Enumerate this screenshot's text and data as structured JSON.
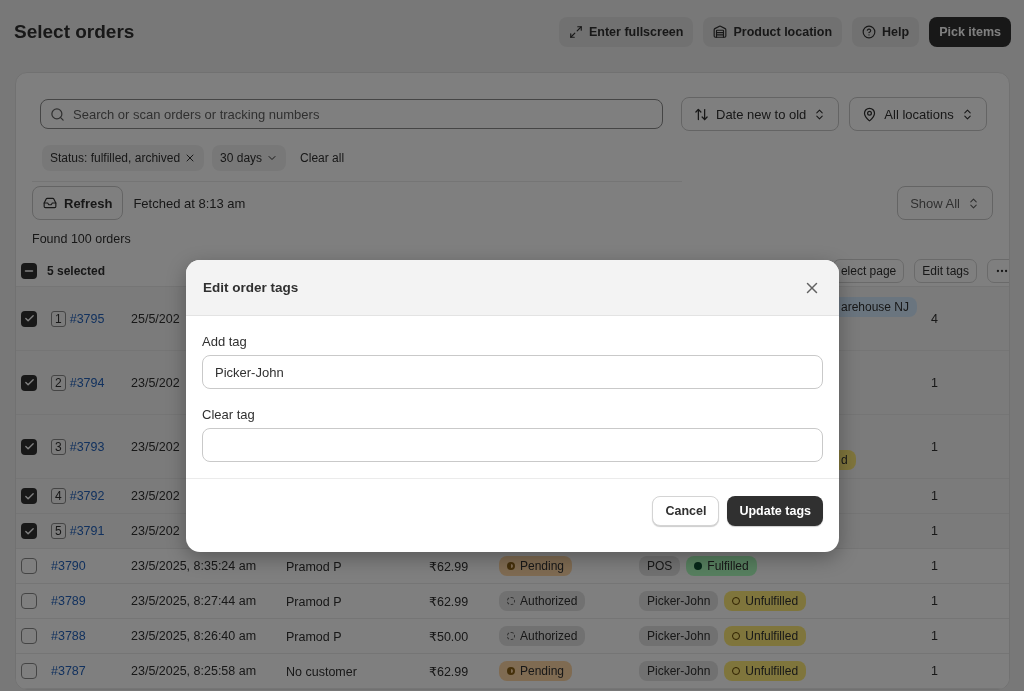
{
  "page": {
    "title": "Select orders"
  },
  "header_buttons": [
    {
      "label": "Enter fullscreen",
      "kind": "fullscreen"
    },
    {
      "label": "Product location",
      "kind": "location"
    },
    {
      "label": "Help",
      "kind": "help"
    },
    {
      "label": "Pick items",
      "kind": "primary"
    }
  ],
  "search": {
    "placeholder": "Search or scan orders or tracking numbers"
  },
  "sort": {
    "value": "Date new to old"
  },
  "location_filter": {
    "value": "All locations"
  },
  "filters": [
    {
      "label": "Status: fulfilled, archived",
      "kind": "removable"
    },
    {
      "label": "30 days",
      "kind": "dropdown"
    }
  ],
  "clear_all": "Clear all",
  "refresh": {
    "label": "Refresh"
  },
  "fetched": "Fetched at 8:13 am",
  "show": {
    "value": "Show All"
  },
  "found": "Found 100 orders",
  "bulk": {
    "count": "5 selected",
    "partial": true,
    "actions": [
      "elect page",
      "Edit tags"
    ]
  },
  "rows": [
    {
      "selected": true,
      "index": "1",
      "order": "#3795",
      "date": "25/5/202",
      "expanded": true,
      "edge": [
        {
          "kind": "location",
          "text": "arehouse NJ"
        }
      ],
      "quantity": "4"
    },
    {
      "selected": true,
      "index": "2",
      "order": "#3794",
      "date": "23/5/202",
      "expanded": true,
      "quantity": "1"
    },
    {
      "selected": true,
      "index": "3",
      "order": "#3793",
      "date": "23/5/202",
      "expanded": true,
      "edge": [
        {
          "kind": "unfulfilled",
          "text": "d"
        }
      ],
      "quantity": "1"
    },
    {
      "selected": true,
      "index": "4",
      "order": "#3792",
      "date": "23/5/202",
      "expanded": false,
      "quantity": "1"
    },
    {
      "selected": true,
      "index": "5",
      "order": "#3791",
      "date": "23/5/202",
      "expanded": false,
      "quantity": "1"
    },
    {
      "selected": false,
      "order": "#3790",
      "date": "23/5/2025, 8:35:24 am",
      "customer": "Pramod P",
      "amount": "₹62.99",
      "payment": {
        "text": "Pending",
        "kind": "pending"
      },
      "tags": [
        "POS"
      ],
      "fulfillment": {
        "text": "Fulfilled",
        "kind": "fulfilled"
      },
      "quantity": "1"
    },
    {
      "selected": false,
      "order": "#3789",
      "date": "23/5/2025, 8:27:44 am",
      "customer": "Pramod P",
      "amount": "₹62.99",
      "payment": {
        "text": "Authorized",
        "kind": "authorized"
      },
      "tags": [
        "Picker-John"
      ],
      "fulfillment": {
        "text": "Unfulfilled",
        "kind": "unfulfilled"
      },
      "quantity": "1"
    },
    {
      "selected": false,
      "order": "#3788",
      "date": "23/5/2025, 8:26:40 am",
      "customer": "Pramod P",
      "amount": "₹50.00",
      "payment": {
        "text": "Authorized",
        "kind": "authorized"
      },
      "tags": [
        "Picker-John"
      ],
      "fulfillment": {
        "text": "Unfulfilled",
        "kind": "unfulfilled"
      },
      "quantity": "1"
    },
    {
      "selected": false,
      "order": "#3787",
      "date": "23/5/2025, 8:25:58 am",
      "customer": "No customer",
      "amount": "₹62.99",
      "payment": {
        "text": "Pending",
        "kind": "pending"
      },
      "tags": [
        "Picker-John"
      ],
      "fulfillment": {
        "text": "Unfulfilled",
        "kind": "unfulfilled"
      },
      "quantity": "1"
    }
  ],
  "modal": {
    "title": "Edit order tags",
    "fields": [
      {
        "label": "Add tag",
        "value": "Picker-John"
      },
      {
        "label": "Clear tag"
      }
    ],
    "buttons": [
      {
        "label": "Cancel",
        "primary": false
      },
      {
        "label": "Update tags",
        "primary": true
      }
    ]
  }
}
